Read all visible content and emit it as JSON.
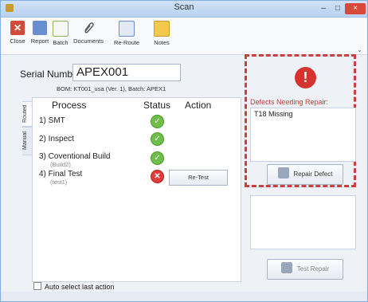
{
  "window": {
    "title": "Scan",
    "min": "–",
    "max": "□",
    "close": "×"
  },
  "toolbar": {
    "close": "Close",
    "report": "Report",
    "batch": "Batch",
    "documents": "Documents",
    "reroute": "Re-Route",
    "notes": "Notes"
  },
  "serial": {
    "label": "Serial Number:",
    "value": "APEX001"
  },
  "bom_line": "BOM: KT001_usa (Ver. 1), Batch: APEX1",
  "tabs": {
    "routed": "Routed",
    "manual": "Manual"
  },
  "process_table": {
    "headers": {
      "process": "Process",
      "status": "Status",
      "action": "Action"
    },
    "rows": [
      {
        "name": "1)  SMT",
        "status": "ok"
      },
      {
        "name": "2)  Inspect",
        "status": "ok"
      },
      {
        "name": "3)  Coventional Build",
        "sub": "(Build2)",
        "status": "ok"
      },
      {
        "name": "4)  Final Test",
        "sub": "(test1)",
        "status": "error",
        "action": "Re-Test"
      }
    ]
  },
  "auto_select_label": "Auto select last action",
  "defects": {
    "label": "Defects Needing Repair:",
    "items": [
      "T18  Missing"
    ],
    "repair_button": "Repair Defect",
    "test_repair_button": "Test Repair"
  },
  "colors": {
    "accent_red": "#c8423d",
    "ok_green": "#6fbe4a",
    "error_red": "#e03c3c"
  },
  "icons": {
    "close": "close-x-icon",
    "report": "report-icon",
    "batch": "checklist-icon",
    "documents": "paperclip-icon",
    "reroute": "reroute-icon",
    "notes": "notes-icon",
    "ok": "checkmark-icon",
    "error": "x-circle-icon",
    "alert": "exclamation-icon",
    "tools": "tools-icon"
  }
}
